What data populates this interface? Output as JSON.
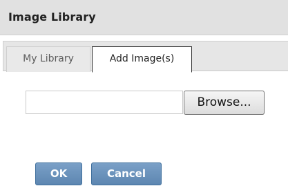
{
  "dialog": {
    "title": "Image Library"
  },
  "tabs": [
    {
      "label": "My Library",
      "active": false
    },
    {
      "label": "Add Image(s)",
      "active": true
    }
  ],
  "upload": {
    "file_value": "",
    "browse_label": "Browse..."
  },
  "actions": {
    "ok_label": "OK",
    "cancel_label": "Cancel"
  },
  "colors": {
    "titlebar_bg": "#e1e1e1",
    "tabstrip_bg": "#e6e6e6",
    "action_button_bg": "#6a92bb",
    "action_button_text": "#ffffff"
  }
}
